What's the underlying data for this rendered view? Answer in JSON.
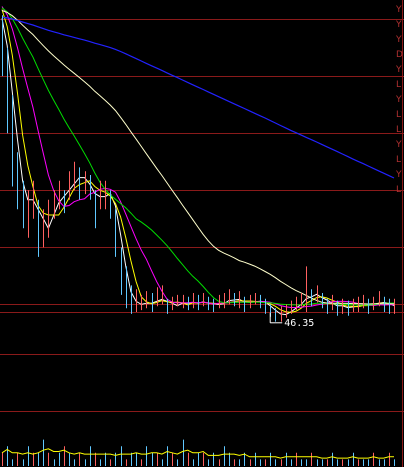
{
  "chart_data": {
    "type": "line",
    "title": "",
    "xlabel": "",
    "ylabel": "",
    "low_annotation": {
      "label": "46.35",
      "value": 46.35,
      "bar_index": 52
    },
    "price_panel": {
      "ylim": [
        44.5,
        63.0
      ],
      "grid_levels": [
        62.0,
        59.0,
        56.0,
        53.0,
        50.0,
        47.0,
        46.6
      ],
      "close": [
        60.5,
        58.5,
        55.5,
        53.0,
        52.0,
        52.5,
        53.0,
        50.5,
        51.0,
        51.5,
        52.5,
        53.0,
        52.5,
        53.5,
        54.0,
        53.5,
        53.5,
        53.0,
        52.0,
        53.0,
        53.0,
        52.5,
        51.0,
        48.5,
        47.5,
        47.0,
        47.0,
        47.0,
        47.2,
        47.0,
        47.3,
        47.5,
        46.7,
        47.0,
        47.1,
        47.1,
        47.0,
        47.2,
        47.0,
        47.2,
        47.0,
        46.9,
        47.1,
        47.1,
        47.4,
        47.2,
        47.2,
        47.0,
        47.1,
        47.3,
        47.1,
        47.0,
        46.7,
        46.4,
        46.4,
        46.6,
        46.8,
        47.0,
        47.2,
        47.7,
        47.3,
        47.6,
        47.2,
        46.9,
        47.1,
        46.8,
        46.9,
        46.8,
        46.9,
        47.0,
        47.1,
        46.9,
        47.0,
        47.3,
        47.0,
        46.9,
        46.9
      ],
      "ticks": [
        {
          "i": 0,
          "h": 62.2,
          "l": 59.0
        },
        {
          "i": 1,
          "h": 60.5,
          "l": 56.0
        },
        {
          "i": 2,
          "h": 58.0,
          "l": 53.2
        },
        {
          "i": 3,
          "h": 55.0,
          "l": 52.0
        },
        {
          "i": 4,
          "h": 53.5,
          "l": 51.0
        },
        {
          "i": 5,
          "h": 53.0,
          "l": 50.5
        },
        {
          "i": 6,
          "h": 53.5,
          "l": 51.5
        },
        {
          "i": 7,
          "h": 52.5,
          "l": 49.5
        },
        {
          "i": 8,
          "h": 52.0,
          "l": 50.0
        },
        {
          "i": 9,
          "h": 52.5,
          "l": 50.5
        },
        {
          "i": 10,
          "h": 53.0,
          "l": 51.5
        },
        {
          "i": 11,
          "h": 53.5,
          "l": 52.0
        },
        {
          "i": 12,
          "h": 53.0,
          "l": 51.8
        },
        {
          "i": 13,
          "h": 54.0,
          "l": 52.5
        },
        {
          "i": 14,
          "h": 54.5,
          "l": 53.0
        },
        {
          "i": 15,
          "h": 54.2,
          "l": 52.5
        },
        {
          "i": 16,
          "h": 54.0,
          "l": 52.8
        },
        {
          "i": 17,
          "h": 53.8,
          "l": 52.5
        },
        {
          "i": 18,
          "h": 53.0,
          "l": 51.0
        },
        {
          "i": 19,
          "h": 53.5,
          "l": 52.0
        },
        {
          "i": 20,
          "h": 53.5,
          "l": 52.0
        },
        {
          "i": 21,
          "h": 53.0,
          "l": 51.5
        },
        {
          "i": 22,
          "h": 52.0,
          "l": 49.5
        },
        {
          "i": 23,
          "h": 50.0,
          "l": 47.5
        },
        {
          "i": 24,
          "h": 49.0,
          "l": 46.8
        },
        {
          "i": 25,
          "h": 48.0,
          "l": 46.5
        },
        {
          "i": 26,
          "h": 47.8,
          "l": 46.6
        },
        {
          "i": 27,
          "h": 47.5,
          "l": 46.7
        },
        {
          "i": 28,
          "h": 47.7,
          "l": 46.8
        },
        {
          "i": 29,
          "h": 47.6,
          "l": 46.6
        },
        {
          "i": 30,
          "h": 47.9,
          "l": 46.9
        },
        {
          "i": 31,
          "h": 48.0,
          "l": 47.0
        },
        {
          "i": 32,
          "h": 47.3,
          "l": 46.5
        },
        {
          "i": 33,
          "h": 47.4,
          "l": 46.7
        },
        {
          "i": 34,
          "h": 47.5,
          "l": 46.9
        },
        {
          "i": 35,
          "h": 47.5,
          "l": 46.8
        },
        {
          "i": 36,
          "h": 47.4,
          "l": 46.7
        },
        {
          "i": 37,
          "h": 47.6,
          "l": 46.8
        },
        {
          "i": 38,
          "h": 47.5,
          "l": 46.7
        },
        {
          "i": 39,
          "h": 47.6,
          "l": 46.9
        },
        {
          "i": 40,
          "h": 47.4,
          "l": 46.7
        },
        {
          "i": 41,
          "h": 47.3,
          "l": 46.6
        },
        {
          "i": 42,
          "h": 47.5,
          "l": 46.8
        },
        {
          "i": 43,
          "h": 47.6,
          "l": 46.8
        },
        {
          "i": 44,
          "h": 47.8,
          "l": 47.0
        },
        {
          "i": 45,
          "h": 47.6,
          "l": 46.9
        },
        {
          "i": 46,
          "h": 47.7,
          "l": 46.8
        },
        {
          "i": 47,
          "h": 47.4,
          "l": 46.6
        },
        {
          "i": 48,
          "h": 47.5,
          "l": 46.8
        },
        {
          "i": 49,
          "h": 47.6,
          "l": 47.0
        },
        {
          "i": 50,
          "h": 47.5,
          "l": 46.8
        },
        {
          "i": 51,
          "h": 47.3,
          "l": 46.5
        },
        {
          "i": 52,
          "h": 47.0,
          "l": 46.35
        },
        {
          "i": 53,
          "h": 46.8,
          "l": 46.1
        },
        {
          "i": 54,
          "h": 46.9,
          "l": 46.1
        },
        {
          "i": 55,
          "h": 47.0,
          "l": 46.3
        },
        {
          "i": 56,
          "h": 47.2,
          "l": 46.5
        },
        {
          "i": 57,
          "h": 47.4,
          "l": 46.7
        },
        {
          "i": 58,
          "h": 47.6,
          "l": 46.9
        },
        {
          "i": 59,
          "h": 49.0,
          "l": 46.6
        },
        {
          "i": 60,
          "h": 47.8,
          "l": 46.9
        },
        {
          "i": 61,
          "h": 48.0,
          "l": 47.1
        },
        {
          "i": 62,
          "h": 47.6,
          "l": 46.8
        },
        {
          "i": 63,
          "h": 47.3,
          "l": 46.5
        },
        {
          "i": 64,
          "h": 47.5,
          "l": 46.7
        },
        {
          "i": 65,
          "h": 47.2,
          "l": 46.4
        },
        {
          "i": 66,
          "h": 47.3,
          "l": 46.5
        },
        {
          "i": 67,
          "h": 47.2,
          "l": 46.4
        },
        {
          "i": 68,
          "h": 47.3,
          "l": 46.6
        },
        {
          "i": 69,
          "h": 47.4,
          "l": 46.6
        },
        {
          "i": 70,
          "h": 47.5,
          "l": 46.8
        },
        {
          "i": 71,
          "h": 47.3,
          "l": 46.5
        },
        {
          "i": 72,
          "h": 47.4,
          "l": 46.7
        },
        {
          "i": 73,
          "h": 47.7,
          "l": 46.9
        },
        {
          "i": 74,
          "h": 47.4,
          "l": 46.6
        },
        {
          "i": 75,
          "h": 47.3,
          "l": 46.5
        },
        {
          "i": 76,
          "h": 47.3,
          "l": 46.5
        }
      ],
      "ma_colors": [
        "#ffffff",
        "#ffff00",
        "#ff00ff",
        "#00dd00",
        "#ffffcc",
        "#2222ff"
      ],
      "ma_periods": [
        3,
        5,
        10,
        20,
        40,
        120
      ],
      "ma_long_anchor": [
        62.8,
        63.0,
        62.9,
        62.7,
        62.5,
        62.1
      ]
    },
    "volume_panel": {
      "ylim": [
        0,
        10
      ],
      "values": [
        2,
        3,
        1,
        2,
        1,
        3,
        2,
        2,
        4,
        2,
        1,
        2,
        3,
        2,
        1,
        2,
        1,
        3,
        2,
        1,
        2,
        1,
        2,
        3,
        1,
        2,
        2,
        1,
        3,
        2,
        2,
        1,
        3,
        2,
        1,
        4,
        2,
        1,
        2,
        2,
        1,
        2,
        1,
        3,
        2,
        1,
        1,
        2,
        1,
        2,
        1,
        1,
        2,
        1,
        1,
        2,
        1,
        2,
        1,
        1,
        2,
        1,
        1,
        1,
        2,
        1,
        1,
        1,
        2,
        1,
        1,
        1,
        2,
        1,
        1,
        2,
        1
      ]
    },
    "grid_color": "#8a1a1a",
    "edge_marks": [
      "Y",
      "Y",
      "Y",
      "D",
      "Y",
      "L",
      "Y",
      "L",
      "L",
      "Y",
      "L",
      "Y",
      "L"
    ]
  }
}
